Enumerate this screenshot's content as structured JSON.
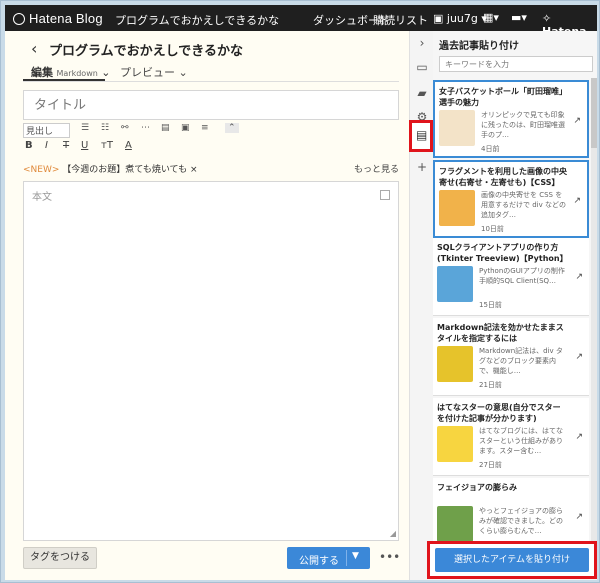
{
  "topbar": {
    "logo": "Hatena Blog",
    "blog_title": "プログラムでおかえしできるかな",
    "dashboard": "ダッシュボード",
    "reading_list": "購読リスト",
    "user": "juu7g",
    "brand": "Hatena"
  },
  "editor": {
    "back_icon": "chevron-left-icon",
    "page_title": "プログラムでおかえしできるかな",
    "tab_edit": "編集",
    "tab_edit_mode": "Markdown",
    "tab_preview": "プレビュー",
    "title_placeholder": "タイトル",
    "news_new": "<NEW>",
    "news_text": "【今週のお題】煮ても焼いても",
    "news_more": "もっと見る",
    "body_placeholder": "本文",
    "tag_button": "タグをつける",
    "publish_button": "公開する",
    "more": "•••",
    "heading_select": "見出し"
  },
  "panel": {
    "title": "過去記事貼り付け",
    "search_placeholder": "キーワードを入力",
    "paste_button": "選択したアイテムを貼り付け",
    "articles": [
      {
        "title": "女子バスケットボール「町田瑠唯」選手の魅力",
        "excerpt": "オリンピックで見ても印象に残ったのは、町田瑠唯選手のプ…",
        "date": "4日前",
        "selected": true,
        "thumb": "#f3e3c8"
      },
      {
        "title": "フラグメントを利用した画像の中央寄せ(右寄せ・左寄せも)【CSS】",
        "excerpt": "画像の中央寄せを CSS を用意するだけで div などの追加タグ…",
        "date": "10日前",
        "selected": true,
        "thumb": "#f1b24a"
      },
      {
        "title": "SQLクライアントアプリの作り方(Tkinter Treeview)【Python】",
        "excerpt": "PythonのGUIアプリの制作手順的SQL Client(SQ…",
        "date": "15日前",
        "selected": false,
        "thumb": "#5aa5d9"
      },
      {
        "title": "Markdown記法を効かせたままスタイルを指定するには",
        "excerpt": "Markdown記法は、div タグなどのブロック要素内で、機能し…",
        "date": "21日前",
        "selected": false,
        "thumb": "#e6c32b"
      },
      {
        "title": "はてなスターの意思(自分でスターを付けた記事が分かります)",
        "excerpt": "はてなブログには、はてなスターという仕組みがあります。スター含む…",
        "date": "27日前",
        "selected": false,
        "thumb": "#f7d540"
      },
      {
        "title": "フェイジョアの膨らみ",
        "excerpt": "やっとフェイジョアの膨らみが確認できました。どのくらい膨らむんで…",
        "date": "",
        "selected": false,
        "thumb": "#6fa04a"
      }
    ]
  },
  "icons": {
    "sidebar": [
      "chevron-right-icon",
      "screen-icon",
      "folder-icon",
      "gear-icon",
      "document-icon",
      "plus-icon"
    ]
  }
}
